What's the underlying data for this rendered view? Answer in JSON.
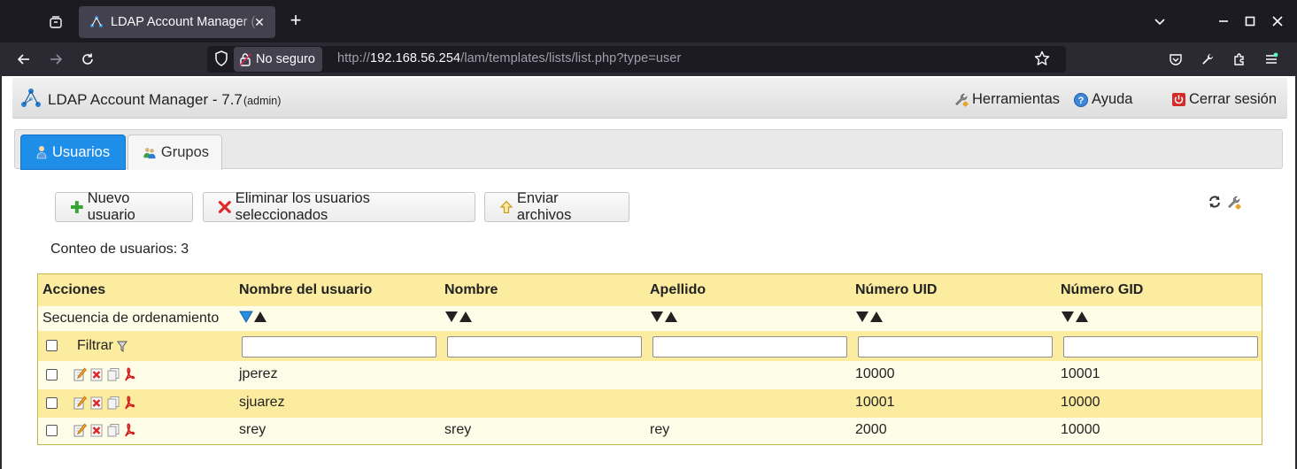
{
  "browser": {
    "tab_title": "LDAP Account Manager (",
    "security_label": "No seguro",
    "url_prefix": "http://",
    "url_host": "192.168.56.254",
    "url_path": "/lam/templates/lists/list.php?type=user"
  },
  "header": {
    "app_title": "LDAP Account Manager - 7.7",
    "user_badge": "(admin)",
    "tools_label": "Herramientas",
    "help_label": "Ayuda",
    "logout_label": "Cerrar sesión"
  },
  "tabs": [
    {
      "label": "Usuarios",
      "active": true,
      "icon": "user-icon"
    },
    {
      "label": "Grupos",
      "active": false,
      "icon": "group-icon"
    }
  ],
  "toolbar": {
    "new_label": "Nuevo usuario",
    "delete_label": "Eliminar los usuarios seleccionados",
    "upload_label": "Enviar archivos"
  },
  "count": {
    "label": "Conteo de usuarios:",
    "value": "3"
  },
  "table": {
    "actions_header": "Acciones",
    "columns": [
      "Nombre del usuario",
      "Nombre",
      "Apellido",
      "Número UID",
      "Número GID"
    ],
    "sort_label": "Secuencia de ordenamiento",
    "filter_label": "Filtrar",
    "rows": [
      {
        "cells": [
          "jperez",
          "",
          "",
          "10000",
          "10001"
        ]
      },
      {
        "cells": [
          "sjuarez",
          "",
          "",
          "10001",
          "10000"
        ]
      },
      {
        "cells": [
          "srey",
          "srey",
          "rey",
          "2000",
          "10000"
        ]
      }
    ]
  },
  "colors": {
    "accent": "#1f8ee8",
    "row_dark": "#fbeca0",
    "row_light": "#fefde8",
    "border": "#c8b550"
  }
}
